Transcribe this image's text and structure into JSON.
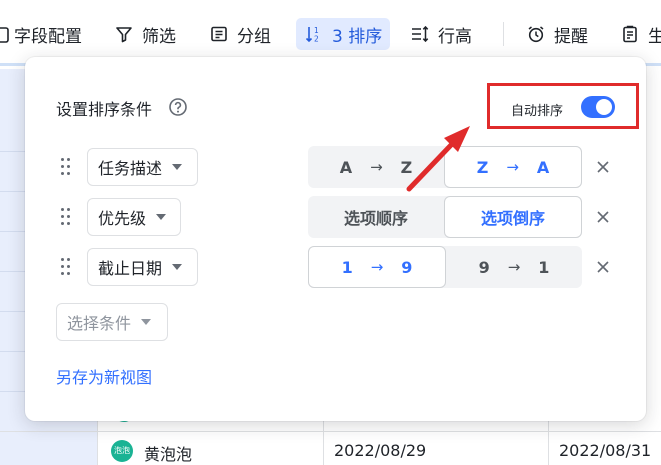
{
  "toolbar": {
    "items": [
      {
        "label": "字段配置",
        "icon": "field-config-icon"
      },
      {
        "label": "筛选",
        "icon": "filter-icon"
      },
      {
        "label": "分组",
        "icon": "group-icon"
      },
      {
        "label": "3 排序",
        "icon": "sort-icon",
        "active": true
      },
      {
        "label": "行高",
        "icon": "row-height-icon"
      },
      {
        "label": "提醒",
        "icon": "alarm-clock-icon"
      },
      {
        "label": "生",
        "icon": "clipboard-icon"
      }
    ]
  },
  "table": {
    "rows": [
      {
        "avatar_text": "泡泡",
        "name": "黄泡泡",
        "start_date": "2022/08/29",
        "end_date": "2022/08/31"
      }
    ]
  },
  "sort_panel": {
    "title": "设置排序条件",
    "auto_sort_label": "自动排序",
    "auto_sort_enabled": true,
    "conditions": [
      {
        "field": "任务描述",
        "options": [
          {
            "from": "A",
            "arrow": "→",
            "to": "Z"
          },
          {
            "from": "Z",
            "arrow": "→",
            "to": "A"
          }
        ],
        "selected": 1
      },
      {
        "field": "优先级",
        "options": [
          {
            "label": "选项顺序"
          },
          {
            "label": "选项倒序"
          }
        ],
        "selected": 1
      },
      {
        "field": "截止日期",
        "options": [
          {
            "from": "1",
            "arrow": "→",
            "to": "9"
          },
          {
            "from": "9",
            "arrow": "→",
            "to": "1"
          }
        ],
        "selected": 0
      }
    ],
    "add_condition_placeholder": "选择条件",
    "save_as_new_view": "另存为新视图"
  },
  "colors": {
    "accent": "#3370ff",
    "annotation_red": "#e02b2b",
    "active_tab_bg": "#e1eaff"
  }
}
